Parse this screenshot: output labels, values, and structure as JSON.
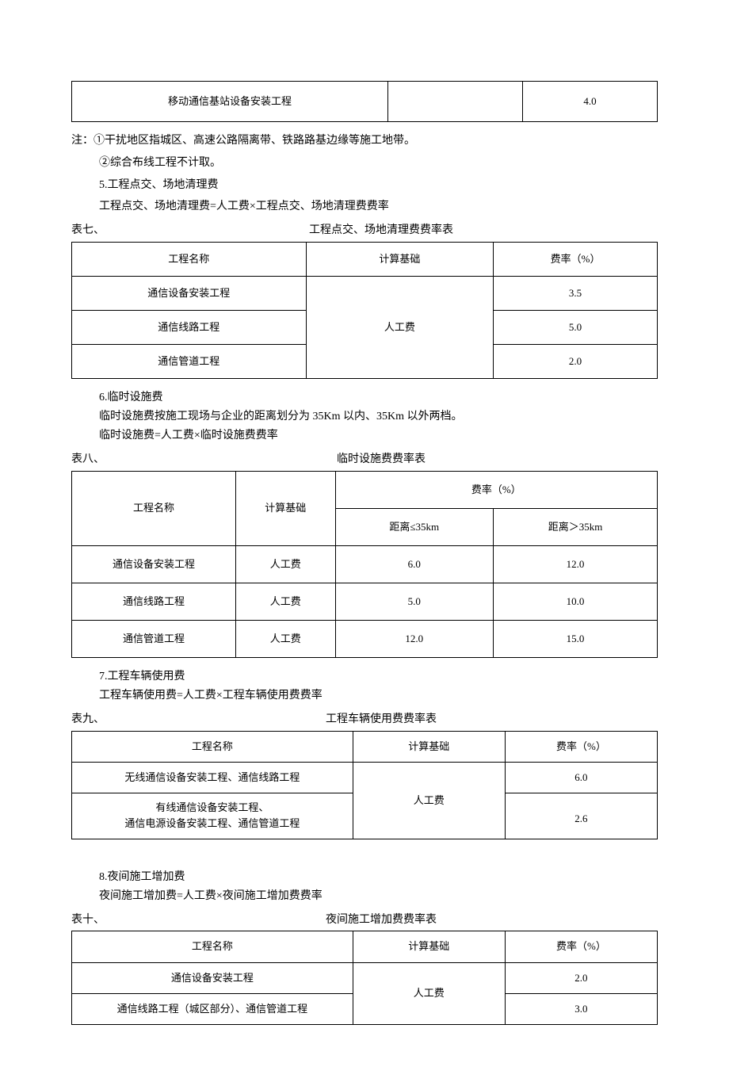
{
  "topTable": {
    "row": {
      "name": "移动通信基站设备安装工程",
      "col2": "",
      "rate": "4.0"
    }
  },
  "notes": {
    "prefix": "注：",
    "n1": "①干扰地区指城区、高速公路隔离带、铁路路基边缘等施工地带。",
    "n2": "②综合布线工程不计取。",
    "s5_title": "5.工程点交、场地清理费",
    "s5_formula": "工程点交、场地清理费=人工费×工程点交、场地清理费费率"
  },
  "t7": {
    "tag": "表七、",
    "title": "工程点交、场地清理费费率表",
    "h1": "工程名称",
    "h2": "计算基础",
    "h3": "费率（%）",
    "basis": "人工费",
    "r1": {
      "name": "通信设备安装工程",
      "rate": "3.5"
    },
    "r2": {
      "name": "通信线路工程",
      "rate": "5.0"
    },
    "r3": {
      "name": "通信管道工程",
      "rate": "2.0"
    }
  },
  "s6": {
    "title": "6.临时设施费",
    "line1": "临时设施费按施工现场与企业的距离划分为 35Km 以内、35Km 以外两档。",
    "line2": "临时设施费=人工费×临时设施费费率"
  },
  "t8": {
    "tag": "表八、",
    "title": "临时设施费费率表",
    "h1": "工程名称",
    "h2": "计算基础",
    "h3": "费率（%）",
    "sub1": "距离≤35km",
    "sub2": "距离＞35km",
    "basis": "人工费",
    "r1": {
      "name": "通信设备安装工程",
      "v1": "6.0",
      "v2": "12.0"
    },
    "r2": {
      "name": "通信线路工程",
      "v1": "5.0",
      "v2": "10.0"
    },
    "r3": {
      "name": "通信管道工程",
      "v1": "12.0",
      "v2": "15.0"
    }
  },
  "s7": {
    "title": "7.工程车辆使用费",
    "line1": "工程车辆使用费=人工费×工程车辆使用费费率"
  },
  "t9": {
    "tag": "表九、",
    "title": "工程车辆使用费费率表",
    "h1": "工程名称",
    "h2": "计算基础",
    "h3": "费率（%）",
    "basis": "人工费",
    "r1": {
      "name": "无线通信设备安装工程、通信线路工程",
      "rate": "6.0"
    },
    "r2": {
      "name_l1": "有线通信设备安装工程、",
      "name_l2": "通信电源设备安装工程、通信管道工程",
      "rate": "2.6"
    }
  },
  "s8": {
    "title": "8.夜间施工增加费",
    "line1": "夜间施工增加费=人工费×夜间施工增加费费率"
  },
  "t10": {
    "tag": "表十、",
    "title": "夜间施工增加费费率表",
    "h1": "工程名称",
    "h2": "计算基础",
    "h3": "费率（%）",
    "basis": "人工费",
    "r1": {
      "name": "通信设备安装工程",
      "rate": "2.0"
    },
    "r2": {
      "name": "通信线路工程（城区部分）、通信管道工程",
      "rate": "3.0"
    }
  }
}
